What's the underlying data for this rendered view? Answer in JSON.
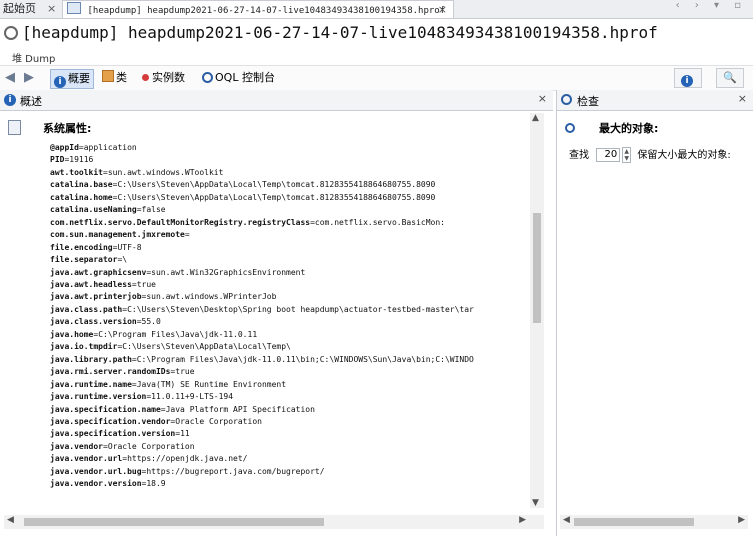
{
  "tabs": {
    "start_label": "起始页",
    "close_glyph": "×",
    "active_label": "[heapdump] heapdump2021-06-27-14-07-live10483493438100194358.hprof",
    "nav_glyphs": "‹ › ▾ ▫"
  },
  "title": "[heapdump] heapdump2021-06-27-14-07-live10483493438100194358.hprof",
  "heap_label": "堆 Dump",
  "toolbar": {
    "back_glyph": "◀",
    "forward_glyph": "▶",
    "summary_label": "概要",
    "classes_label": "类",
    "instances_label": "实例数",
    "oql_label": "OQL 控制台",
    "info_glyph": "i",
    "search_glyph": "🔍"
  },
  "left_panel": {
    "title": "概述",
    "close_glyph": "×",
    "section_title": "系统属性:",
    "properties": [
      {
        "key": "@appId",
        "value": "application"
      },
      {
        "key": "PID",
        "value": "19116"
      },
      {
        "key": "awt.toolkit",
        "value": "sun.awt.windows.WToolkit"
      },
      {
        "key": "catalina.base",
        "value": "C:\\Users\\Steven\\AppData\\Local\\Temp\\tomcat.8128355418864680755.8090"
      },
      {
        "key": "catalina.home",
        "value": "C:\\Users\\Steven\\AppData\\Local\\Temp\\tomcat.8128355418864680755.8090"
      },
      {
        "key": "catalina.useNaming",
        "value": "false"
      },
      {
        "key": "com.netflix.servo.DefaultMonitorRegistry.registryClass",
        "value": "com.netflix.servo.BasicMon:"
      },
      {
        "key": "com.sun.management.jmxremote",
        "value": ""
      },
      {
        "key": "file.encoding",
        "value": "UTF-8"
      },
      {
        "key": "file.separator",
        "value": "\\"
      },
      {
        "key": "java.awt.graphicsenv",
        "value": "sun.awt.Win32GraphicsEnvironment"
      },
      {
        "key": "java.awt.headless",
        "value": "true"
      },
      {
        "key": "java.awt.printerjob",
        "value": "sun.awt.windows.WPrinterJob"
      },
      {
        "key": "java.class.path",
        "value": "C:\\Users\\Steven\\Desktop\\Spring boot heapdump\\actuator-testbed-master\\tar"
      },
      {
        "key": "java.class.version",
        "value": "55.0"
      },
      {
        "key": "java.home",
        "value": "C:\\Program Files\\Java\\jdk-11.0.11"
      },
      {
        "key": "java.io.tmpdir",
        "value": "C:\\Users\\Steven\\AppData\\Local\\Temp\\"
      },
      {
        "key": "java.library.path",
        "value": "C:\\Program Files\\Java\\jdk-11.0.11\\bin;C:\\WINDOWS\\Sun\\Java\\bin;C:\\WINDO"
      },
      {
        "key": "java.rmi.server.randomIDs",
        "value": "true"
      },
      {
        "key": "java.runtime.name",
        "value": "Java(TM) SE Runtime Environment"
      },
      {
        "key": "java.runtime.version",
        "value": "11.0.11+9-LTS-194"
      },
      {
        "key": "java.specification.name",
        "value": "Java Platform API Specification"
      },
      {
        "key": "java.specification.vendor",
        "value": "Oracle Corporation"
      },
      {
        "key": "java.specification.version",
        "value": "11"
      },
      {
        "key": "java.vendor",
        "value": "Oracle Corporation"
      },
      {
        "key": "java.vendor.url",
        "value": "https://openjdk.java.net/"
      },
      {
        "key": "java.vendor.url.bug",
        "value": "https://bugreport.java.com/bugreport/"
      },
      {
        "key": "java.vendor.version",
        "value": "18.9"
      }
    ]
  },
  "right_panel": {
    "title": "检查",
    "close_glyph": "×",
    "section_title": "最大的对象:",
    "find_label": "查找",
    "count_value": "20",
    "suffix_label": "保留大小最大的对象:"
  }
}
